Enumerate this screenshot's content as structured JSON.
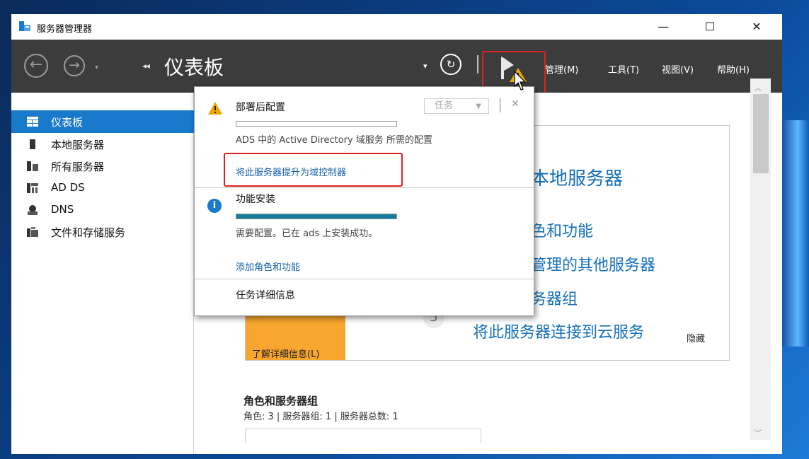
{
  "window": {
    "title": "服务器管理器",
    "controls": {
      "minimize": "—",
      "maximize": "☐",
      "close": "✕"
    }
  },
  "toolbar": {
    "back": "←",
    "forward": "→",
    "dropdown": "▾",
    "breadcrumb_dots": "◂◂",
    "page_title": "仪表板",
    "title_dropdown": "▾",
    "refresh": "↻",
    "menus": {
      "manage": "管理(M)",
      "tools": "工具(T)",
      "view": "视图(V)",
      "help": "帮助(H)"
    }
  },
  "sidebar": {
    "items": [
      {
        "label": "仪表板",
        "icon": "dashboard-icon",
        "active": true
      },
      {
        "label": "本地服务器",
        "icon": "local-server-icon"
      },
      {
        "label": "所有服务器",
        "icon": "all-servers-icon"
      },
      {
        "label": "AD DS",
        "icon": "adds-icon"
      },
      {
        "label": "DNS",
        "icon": "dns-icon"
      },
      {
        "label": "文件和存储服务",
        "icon": "file-storage-icon"
      }
    ]
  },
  "main": {
    "welcome": {
      "steps": [
        {
          "text": "本地服务器"
        },
        {
          "text": "色和功能"
        },
        {
          "text": "管理的其他服务器"
        },
        {
          "text": "务器组"
        },
        {
          "number": "5",
          "text": "将此服务器连接到云服务"
        }
      ],
      "learn_more": "了解详细信息(L)",
      "hide": "隐藏"
    },
    "roles": {
      "title": "角色和服务器组",
      "subtitle": "角色: 3 | 服务器组: 1 | 服务器总数: 1"
    }
  },
  "notifications": {
    "task_dropdown": "任务",
    "close": "✕",
    "items": [
      {
        "title": "部署后配置",
        "description": "ADS 中的 Active Directory 域服务 所需的配置",
        "link": "将此服务器提升为域控制器",
        "progress": 0.0
      },
      {
        "title": "功能安装",
        "description": "需要配置。已在 ads 上安装成功。",
        "link": "添加角色和功能",
        "progress": 1.0
      }
    ],
    "details": "任务详细信息"
  },
  "colors": {
    "accent": "#1979ca",
    "toolbar": "#3c3c3c",
    "warning": "#f0a500",
    "orange_tile": "#f8a62e",
    "highlight": "#e02020"
  }
}
